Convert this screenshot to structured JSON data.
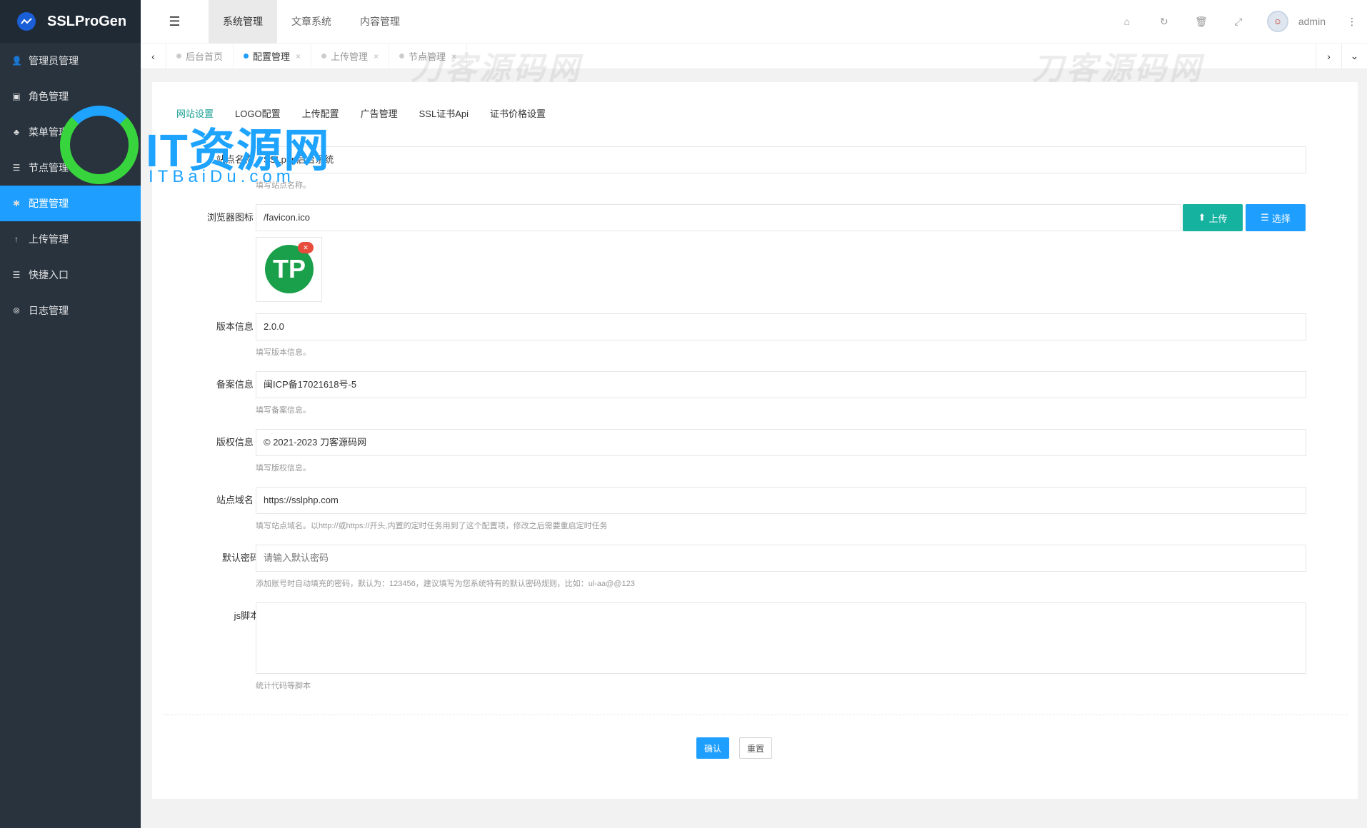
{
  "app": {
    "title": "SSLProGen"
  },
  "sidebar": {
    "items": [
      {
        "label": "管理员管理",
        "icon": "user-icon",
        "glyph": "👤",
        "active": false
      },
      {
        "label": "角色管理",
        "icon": "role-icon",
        "glyph": "▣",
        "active": false
      },
      {
        "label": "菜单管理",
        "icon": "tree-icon",
        "glyph": "♣",
        "active": false
      },
      {
        "label": "节点管理",
        "icon": "list-icon",
        "glyph": "☰",
        "active": false
      },
      {
        "label": "配置管理",
        "icon": "gear-icon",
        "glyph": "✱",
        "active": true
      },
      {
        "label": "上传管理",
        "icon": "upload-arrow-icon",
        "glyph": "↑",
        "active": false
      },
      {
        "label": "快捷入口",
        "icon": "list-icon",
        "glyph": "☰",
        "active": false
      },
      {
        "label": "日志管理",
        "icon": "log-icon",
        "glyph": "⊚",
        "active": false
      }
    ]
  },
  "header": {
    "menu_toggle_icon": "menu-toggle-icon",
    "top_tabs": [
      {
        "label": "系统管理",
        "active": true
      },
      {
        "label": "文章系统",
        "active": false
      },
      {
        "label": "内容管理",
        "active": false
      }
    ],
    "user": {
      "name": "admin"
    }
  },
  "page_tabs": [
    {
      "label": "后台首页",
      "closable": false,
      "active": false
    },
    {
      "label": "配置管理",
      "closable": true,
      "active": true
    },
    {
      "label": "上传管理",
      "closable": true,
      "active": false
    },
    {
      "label": "节点管理",
      "closable": true,
      "active": false
    }
  ],
  "sub_tabs": [
    {
      "label": "网站设置",
      "active": true
    },
    {
      "label": "LOGO配置",
      "active": false
    },
    {
      "label": "上传配置",
      "active": false
    },
    {
      "label": "广告管理",
      "active": false
    },
    {
      "label": "SSL证书Api",
      "active": false
    },
    {
      "label": "证书价格设置",
      "active": false
    }
  ],
  "form": {
    "site_name": {
      "label": "站点名称",
      "value": "SSLphp后台系统",
      "hint": "填写站点名称。"
    },
    "favicon": {
      "label": "浏览器图标",
      "value": "/favicon.ico",
      "upload_label": "上传",
      "select_label": "选择",
      "preview_text": "TP"
    },
    "version": {
      "label": "版本信息",
      "value": "2.0.0",
      "hint": "填写版本信息。"
    },
    "icp": {
      "label": "备案信息",
      "value": "闽ICP备17021618号-5",
      "hint": "填写备案信息。"
    },
    "copyright": {
      "label": "版权信息",
      "value": "© 2021-2023 刀客源码网",
      "hint": "填写版权信息。"
    },
    "domain": {
      "label": "站点域名",
      "value": "https://sslphp.com",
      "hint": "填写站点域名。以http://或https://开头,内置的定时任务用到了这个配置项，修改之后需要重启定时任务"
    },
    "default_password": {
      "label": "默认密码",
      "placeholder": "请输入默认密码",
      "hint": "添加账号时自动填充的密码，默认为：123456，建议填写为您系统特有的默认密码规则，比如：ul-aa@@123"
    },
    "js_script": {
      "label": "js脚本",
      "value": "",
      "hint": "统计代码等脚本"
    },
    "required_mark": "*"
  },
  "actions": {
    "confirm_label": "确认",
    "reset_label": "重置"
  },
  "watermarks": {
    "text": "刀客源码网",
    "brand_title": "IT资源网",
    "brand_sub": "ITBaiDu.com"
  },
  "colors": {
    "sidebar_bg": "#28333e",
    "accent_blue": "#1e9fff",
    "active_subtab": "#1aa094",
    "upload_green": "#16b2a0",
    "required_red": "#ff5722"
  }
}
